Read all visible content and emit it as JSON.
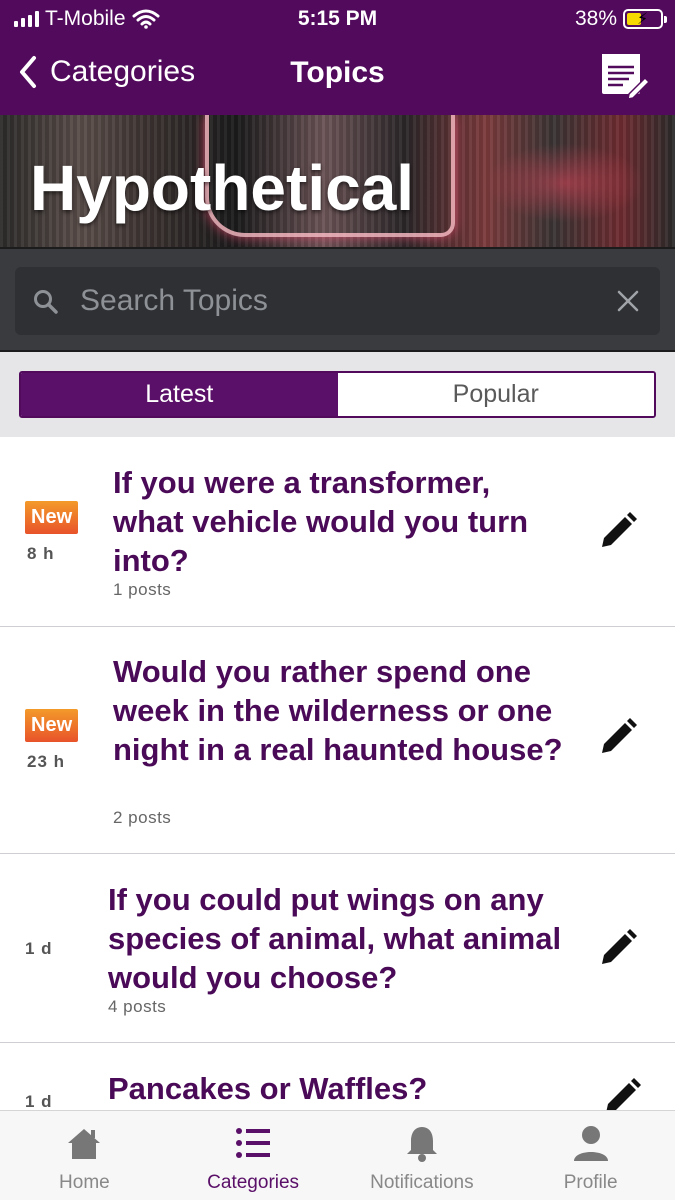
{
  "status": {
    "carrier": "T-Mobile",
    "time": "5:15 PM",
    "battery": "38%"
  },
  "nav": {
    "back_label": "Categories",
    "title": "Topics"
  },
  "banner": {
    "title": "Hypothetical"
  },
  "search": {
    "placeholder": "Search Topics"
  },
  "segments": {
    "latest": "Latest",
    "popular": "Popular",
    "selected": "Latest"
  },
  "topics": [
    {
      "badge": "New",
      "age": "8 h",
      "title": "If you were a transformer, what vehicle would you turn into?",
      "posts": "1 posts"
    },
    {
      "badge": "New",
      "age": "23 h",
      "title": "Would you rather spend one week in the wilderness or one night in a real haunted house?",
      "posts": "2 posts"
    },
    {
      "badge": "",
      "age": "1 d",
      "title": "If you could put wings on any species of animal, what animal would you choose?",
      "posts": "4 posts"
    },
    {
      "badge": "",
      "age": "1 d",
      "title": "Pancakes or Waffles?",
      "posts": ""
    }
  ],
  "tabbar": {
    "home": "Home",
    "categories": "Categories",
    "notifications": "Notifications",
    "profile": "Profile",
    "active": "Categories"
  },
  "colors": {
    "brand": "#520a5c",
    "title_text": "#4a0a57",
    "new_badge": "#ee6f2a"
  }
}
